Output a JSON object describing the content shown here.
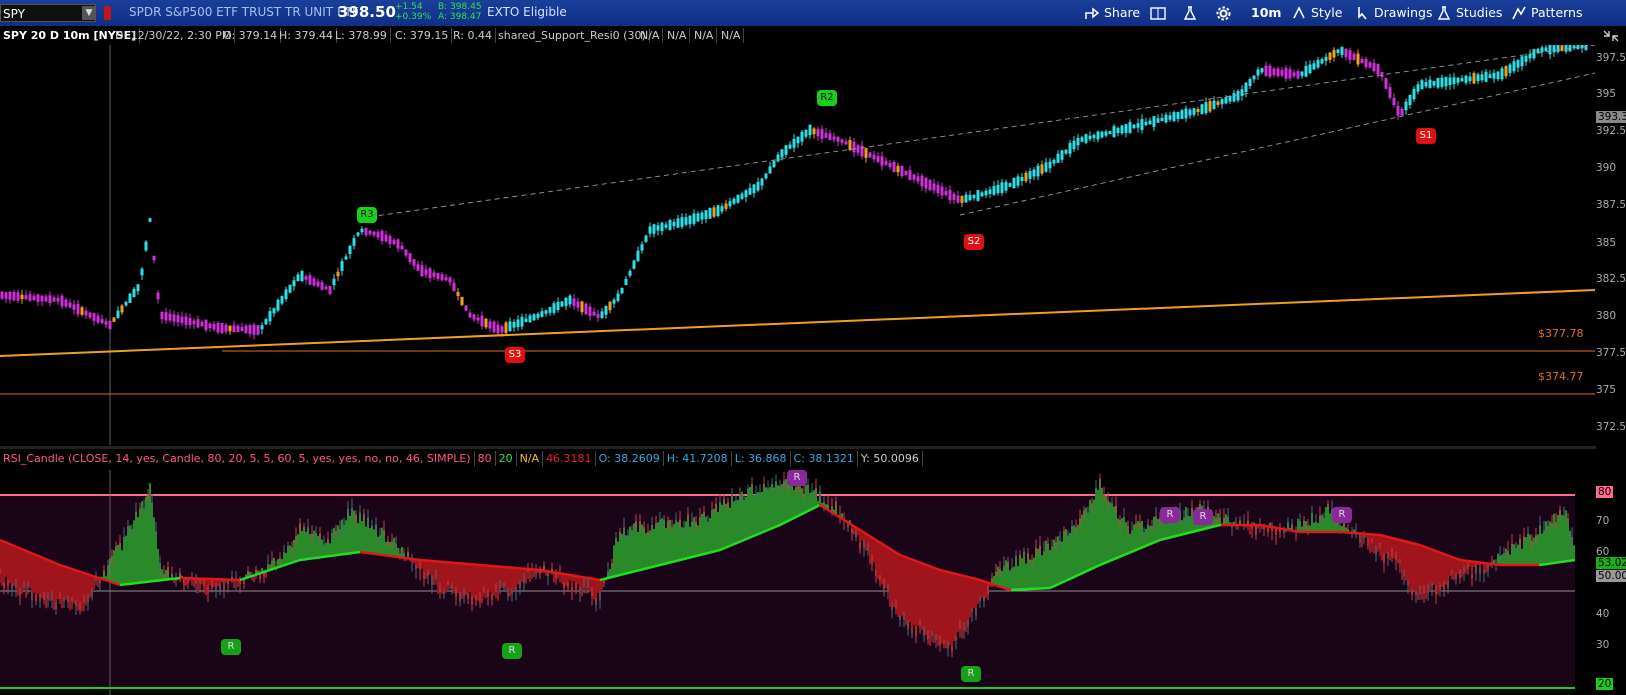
{
  "toolbar": {
    "symbol": "SPY",
    "description": "SPDR S&P500 ETF TRUST TR UNIT ETF",
    "price": "398.50",
    "change": "+1.54",
    "change_pct": "+0.39%",
    "bid": "B: 398.45",
    "ask": "A: 398.47",
    "exto": "EXTO Eligible",
    "share": "Share",
    "interval": "10m",
    "style": "Style",
    "drawings": "Drawings",
    "studies": "Studies",
    "patterns": "Patterns"
  },
  "info": {
    "title": "SPY 20 D 10m [NYSE]",
    "date": "D: 12/30/22, 2:30 PM",
    "open": "O: 379.14",
    "high": "H: 379.44",
    "low": "L: 378.99",
    "close": "C: 379.15",
    "range": "R: 0.44",
    "study": "shared_Support_Resi0 (30)",
    "na1": "N/A",
    "na2": "N/A",
    "na3": "N/A",
    "na4": "N/A"
  },
  "price_axis": [
    "397.5",
    "395",
    "392.5",
    "390",
    "387.5",
    "385",
    "382.5",
    "380",
    "377.5",
    "375",
    "372.5"
  ],
  "current_price_tag": "393.3",
  "levels": {
    "l1": "$377.78",
    "l2": "$374.77"
  },
  "price_badges": {
    "r3": "R3",
    "r2": "R2",
    "s3": "S3",
    "s2": "S2",
    "s1": "S1"
  },
  "rsi": {
    "study": "RSI_Candle (CLOSE, 14, yes, Candle, 80, 20, 5, 5, 60, 5, yes, yes, no, no, 46, SIMPLE)",
    "ob": "80",
    "os": "20",
    "na": "N/A",
    "value": "46.3181",
    "open": "O: 38.2609",
    "high": "H: 41.7208",
    "low": "L: 36.868",
    "close": "C: 38.1321",
    "y": "Y: 50.0096",
    "axis": [
      "70",
      "60",
      "40",
      "30"
    ],
    "ob_tag": "80",
    "os_tag": "20",
    "tag1": "53.02",
    "tag2": "50.00",
    "badge": "R"
  },
  "colors": {
    "up": "#2ee0e8",
    "down": "#d030d8",
    "trend": "#f0a020",
    "rsi_up": "#2a8a2a",
    "rsi_down": "#a0141c",
    "bg": "#000000"
  }
}
